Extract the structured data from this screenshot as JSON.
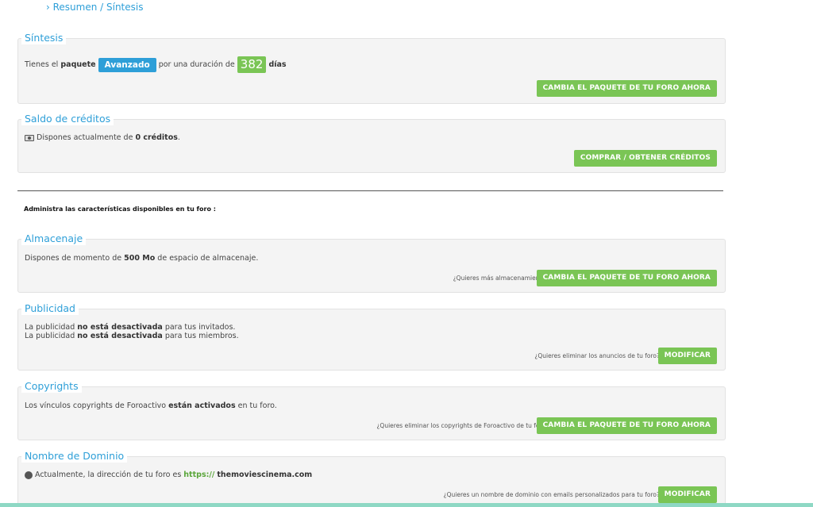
{
  "breadcrumb": "› Resumen / Síntesis",
  "sintesis": {
    "title": "Síntesis",
    "text_before": "Tienes el",
    "paquete_word": "paquete",
    "plan": "Avanzado",
    "text_middle": "por una duración de",
    "days_value": "382",
    "days_label": "días",
    "button": "CAMBIA EL PAQUETE DE TU FORO AHORA"
  },
  "saldo": {
    "title": "Saldo de créditos",
    "icon": "money-icon",
    "text_before": "Dispones actualmente de",
    "credits": "0 créditos",
    "text_after": ".",
    "button": "COMPRAR / OBTENER CRÉDITOS"
  },
  "admin_heading": "Administra las características disponibles en tu foro :",
  "almacenaje": {
    "title": "Almacenaje",
    "text_before": "Dispones de momento de",
    "amount": "500 Mo",
    "text_after": "de espacio de almacenaje.",
    "question": "¿Quieres más almacenamiento?",
    "button": "CAMBIA EL PAQUETE DE TU FORO AHORA"
  },
  "publicidad": {
    "title": "Publicidad",
    "line1_before": "La publicidad",
    "line1_bold": "no está desactivada",
    "line1_after": "para tus invitados.",
    "line2_before": "La publicidad",
    "line2_bold": "no está desactivada",
    "line2_after": "para tus miembros.",
    "question": "¿Quieres eliminar los anuncios de tu foro?",
    "button": "MODIFICAR"
  },
  "copyrights": {
    "title": "Copyrights",
    "text_before": "Los vínculos copyrights de Foroactivo",
    "bold": "están activados",
    "text_after": "en tu foro.",
    "question": "¿Quieres eliminar los copyrights de Foroactivo de tu foro?",
    "button": "CAMBIA EL PAQUETE DE TU FORO AHORA"
  },
  "dominio": {
    "title": "Nombre de Dominio",
    "icon": "globe-icon",
    "text_before": "Actualmente, la dirección de tu foro es",
    "protocol": "https://",
    "domain": "themoviescinema.com",
    "question": "¿Quieres un nombre de dominio con emails personalizados para tu foro?",
    "button": "MODIFICAR"
  }
}
